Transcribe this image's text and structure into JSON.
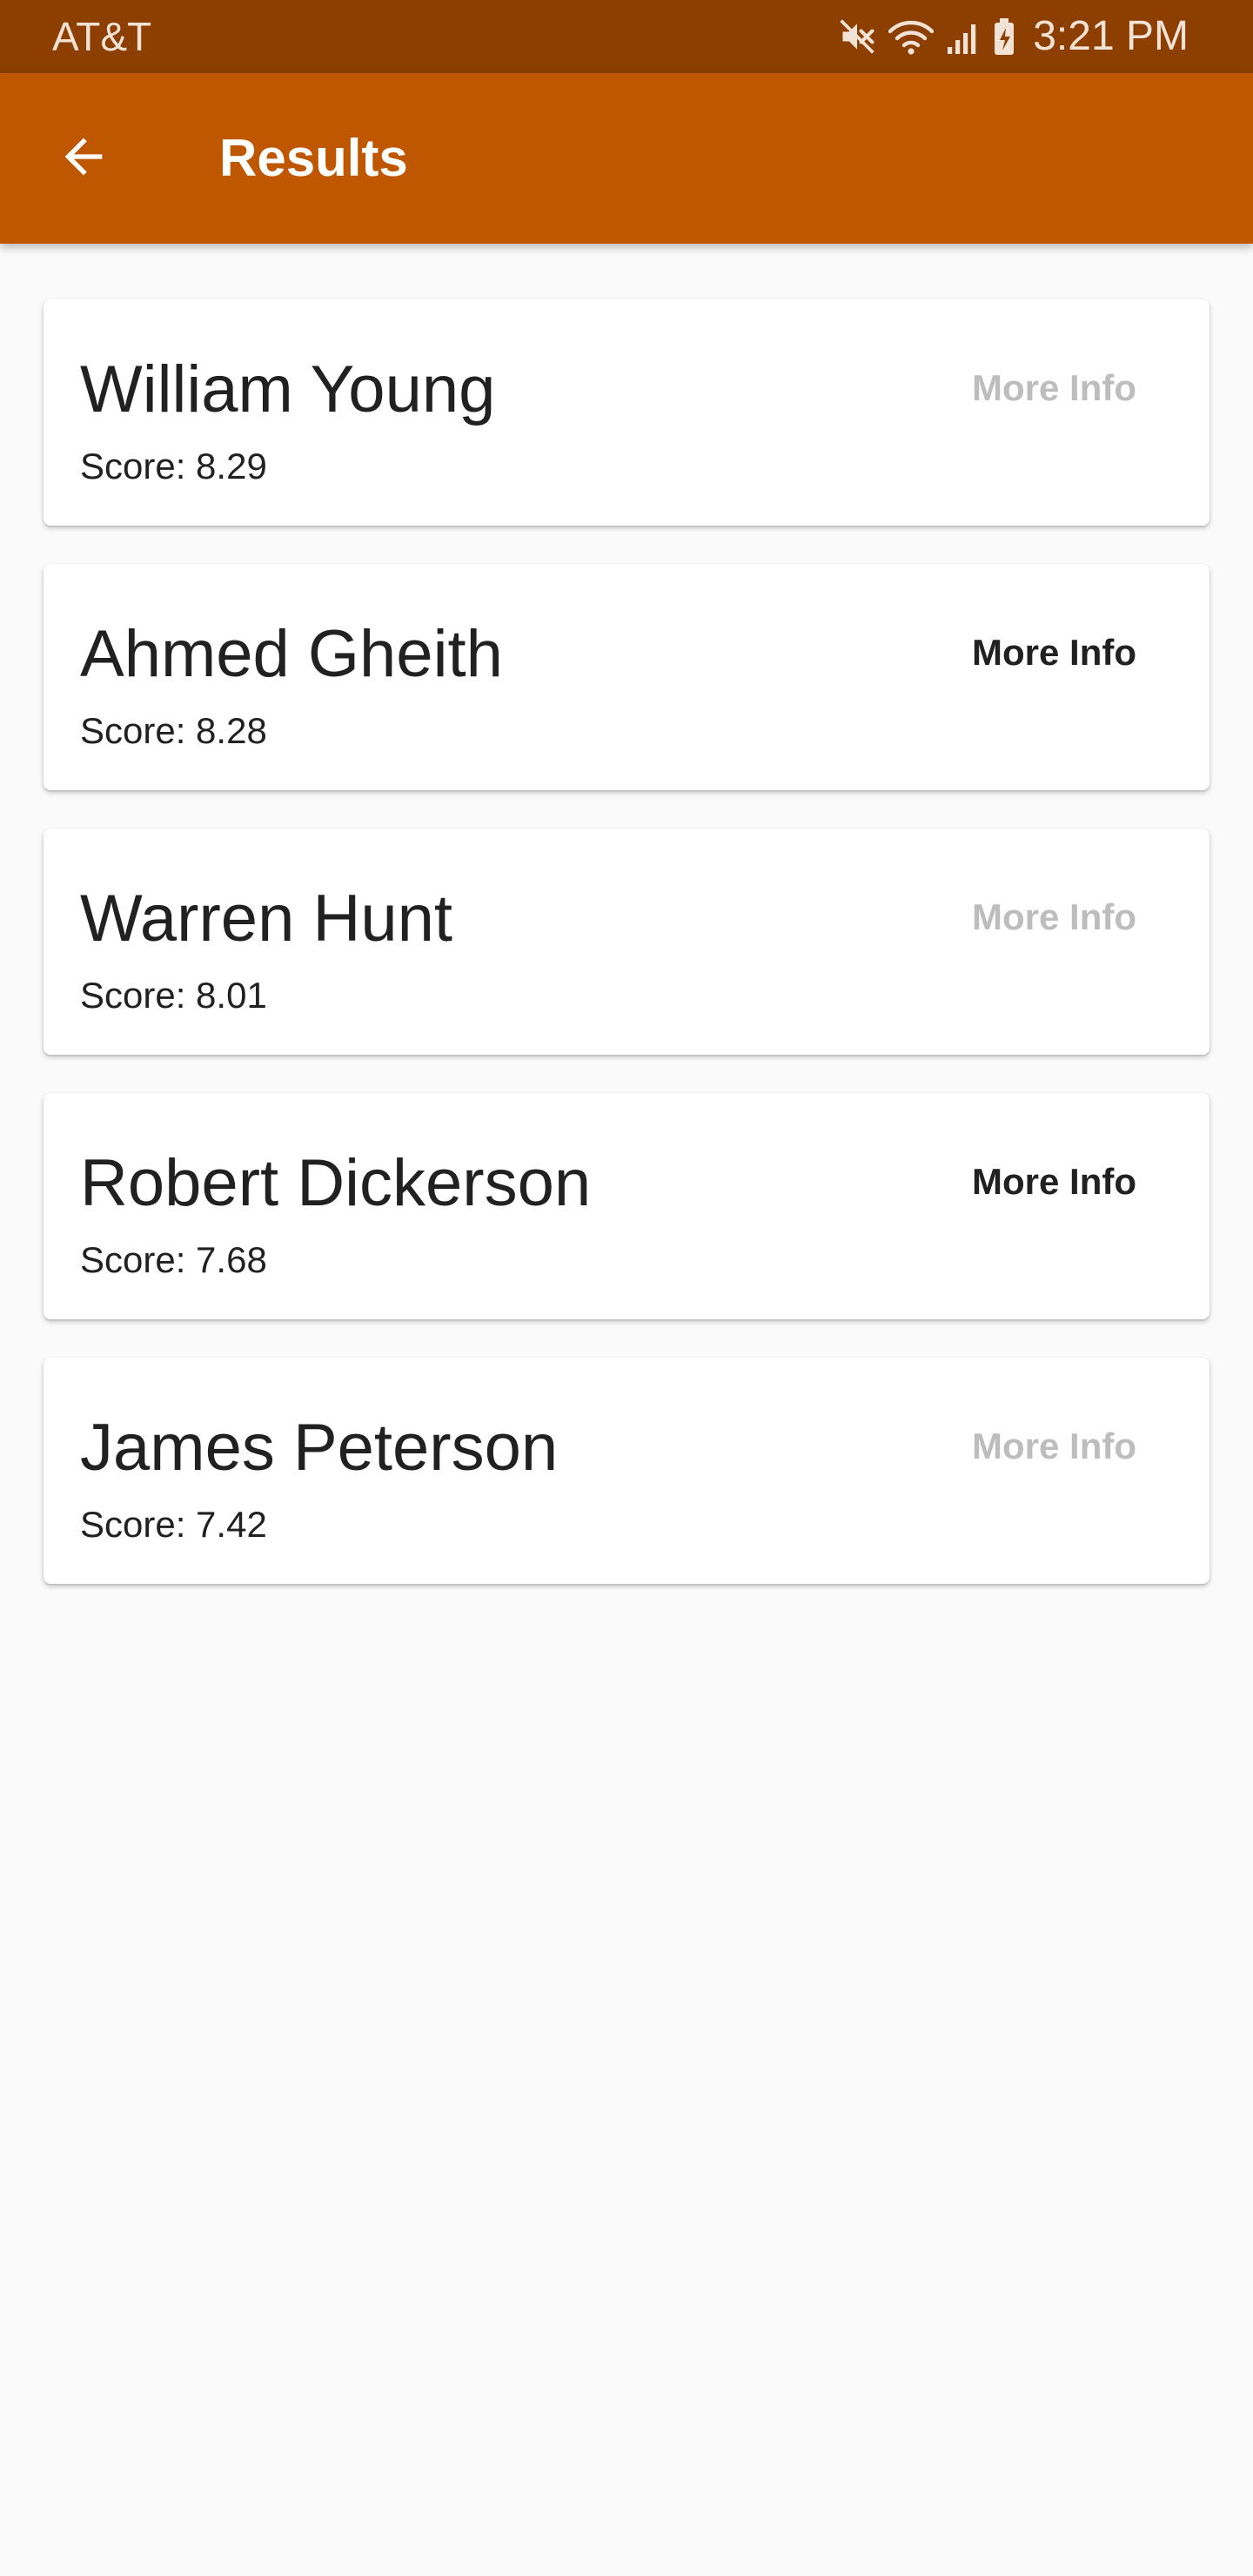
{
  "status_bar": {
    "carrier": "AT&T",
    "time": "3:21 PM",
    "icons": [
      "mute-icon",
      "wifi-icon",
      "signal-icon",
      "battery-charging-icon"
    ]
  },
  "app_bar": {
    "back_icon": "arrow-back-icon",
    "title": "Results"
  },
  "colors": {
    "status_bar": "#8c3f00",
    "app_bar": "#bf5700",
    "background": "#fafafa",
    "text": "#212121",
    "disabled_text": "#bdbdbd"
  },
  "results": [
    {
      "name": "William Young",
      "score": "Score: 8.29",
      "action": "More Info",
      "enabled": false
    },
    {
      "name": "Ahmed Gheith",
      "score": "Score: 8.28",
      "action": "More Info",
      "enabled": true
    },
    {
      "name": "Warren Hunt",
      "score": "Score: 8.01",
      "action": "More Info",
      "enabled": false
    },
    {
      "name": "Robert Dickerson",
      "score": "Score: 7.68",
      "action": "More Info",
      "enabled": true
    },
    {
      "name": "James Peterson",
      "score": "Score: 7.42",
      "action": "More Info",
      "enabled": false
    }
  ]
}
